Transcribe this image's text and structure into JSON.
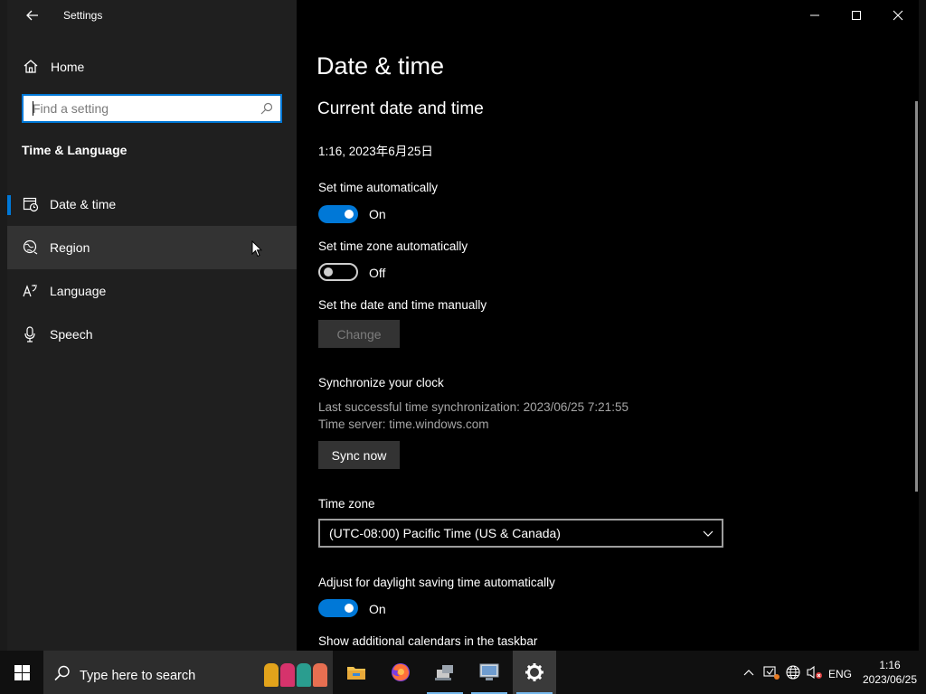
{
  "window": {
    "title": "Settings",
    "controls": {
      "minimize": "minimize",
      "maximize": "maximize",
      "close": "close"
    }
  },
  "sidebar": {
    "home_label": "Home",
    "search_placeholder": "Find a setting",
    "section_title": "Time & Language",
    "items": [
      {
        "label": "Date & time",
        "icon": "calendar-clock-icon",
        "selected": true
      },
      {
        "label": "Region",
        "icon": "globe-icon",
        "hovered": true
      },
      {
        "label": "Language",
        "icon": "language-icon"
      },
      {
        "label": "Speech",
        "icon": "microphone-icon"
      }
    ]
  },
  "main": {
    "page_title": "Date & time",
    "section_current": "Current date and time",
    "current_datetime": "1:16, 2023年6月25日",
    "set_time_auto_label": "Set time automatically",
    "set_time_auto_state": "On",
    "set_tz_auto_label": "Set time zone automatically",
    "set_tz_auto_state": "Off",
    "set_manual_label": "Set the date and time manually",
    "change_button": "Change",
    "sync_heading": "Synchronize your clock",
    "sync_last": "Last successful time synchronization: 2023/06/25 7:21:55",
    "sync_server": "Time server: time.windows.com",
    "sync_button": "Sync now",
    "timezone_label": "Time zone",
    "timezone_value": "(UTC-08:00) Pacific Time (US & Canada)",
    "dst_label": "Adjust for daylight saving time automatically",
    "dst_state": "On",
    "additional_calendars_label": "Show additional calendars in the taskbar"
  },
  "taskbar": {
    "search_placeholder": "Type here to search",
    "apps": [
      "file-explorer-icon",
      "firefox-icon",
      "network-app-icon",
      "computer-app-icon",
      "settings-gear-icon"
    ],
    "tray": {
      "language": "ENG",
      "time": "1:16",
      "date": "2023/06/25"
    }
  },
  "colors": {
    "accent": "#0078d7",
    "sidebar_bg": "#1f1f1f",
    "main_bg": "#000000",
    "hover_bg": "#333333"
  }
}
